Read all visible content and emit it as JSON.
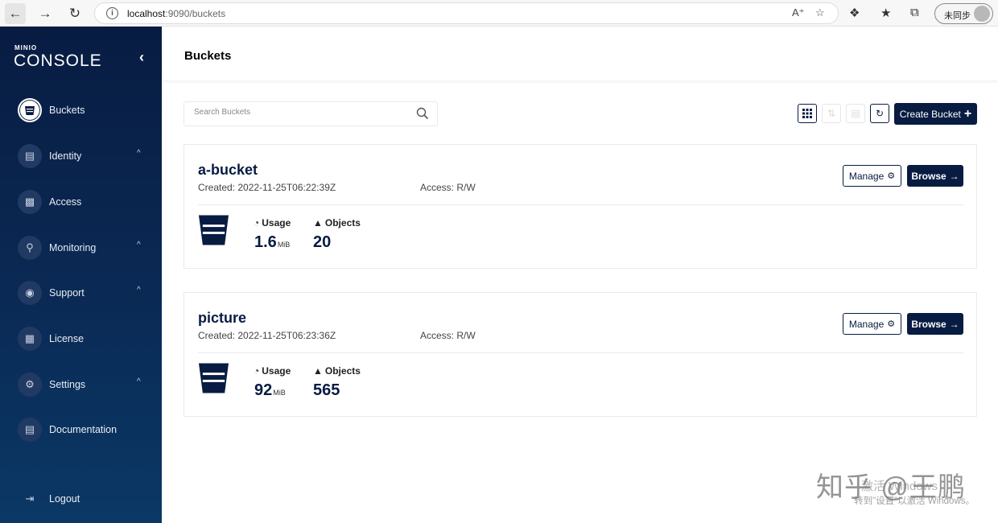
{
  "browser": {
    "url_host": "localhost",
    "url_rest": ":9090/buckets",
    "sync_label": "未同步"
  },
  "sidebar": {
    "logo_top": "MINIO",
    "logo_main": "CONSOLE",
    "items": [
      {
        "label": "Buckets",
        "icon": "bucket-icon",
        "active": true
      },
      {
        "label": "Identity",
        "icon": "id-card-icon",
        "caret": "^"
      },
      {
        "label": "Access",
        "icon": "lock-icon"
      },
      {
        "label": "Monitoring",
        "icon": "magnifier-icon",
        "caret": "^"
      },
      {
        "label": "Support",
        "icon": "support-icon",
        "caret": "^"
      },
      {
        "label": "License",
        "icon": "license-icon"
      },
      {
        "label": "Settings",
        "icon": "gear-icon",
        "caret": "^"
      },
      {
        "label": "Documentation",
        "icon": "document-icon"
      },
      {
        "label": "Logout",
        "icon": "logout-icon"
      }
    ]
  },
  "header": {
    "title": "Buckets"
  },
  "search": {
    "placeholder": "Search Buckets"
  },
  "toolbar": {
    "create_label": "Create Bucket"
  },
  "buckets": [
    {
      "name": "a-bucket",
      "created": "Created: 2022-11-25T06:22:39Z",
      "access": "Access: R/W",
      "manage_label": "Manage",
      "browse_label": "Browse",
      "usage_label": "Usage",
      "usage_value": "1.6",
      "usage_unit": "MiB",
      "objects_label": "Objects",
      "objects_value": "20"
    },
    {
      "name": "picture",
      "created": "Created: 2022-11-25T06:23:36Z",
      "access": "Access: R/W",
      "manage_label": "Manage",
      "browse_label": "Browse",
      "usage_label": "Usage",
      "usage_value": "92",
      "usage_unit": "MiB",
      "objects_label": "Objects",
      "objects_value": "565"
    }
  ],
  "overlay": {
    "watermark": "知乎 @王鹏",
    "activate_line1": "激活 Windows",
    "activate_line2": "转到\"设置\"以激活 Windows。"
  },
  "colors": {
    "brand": "#081c42",
    "sidebar_bottom": "#0b3866"
  }
}
